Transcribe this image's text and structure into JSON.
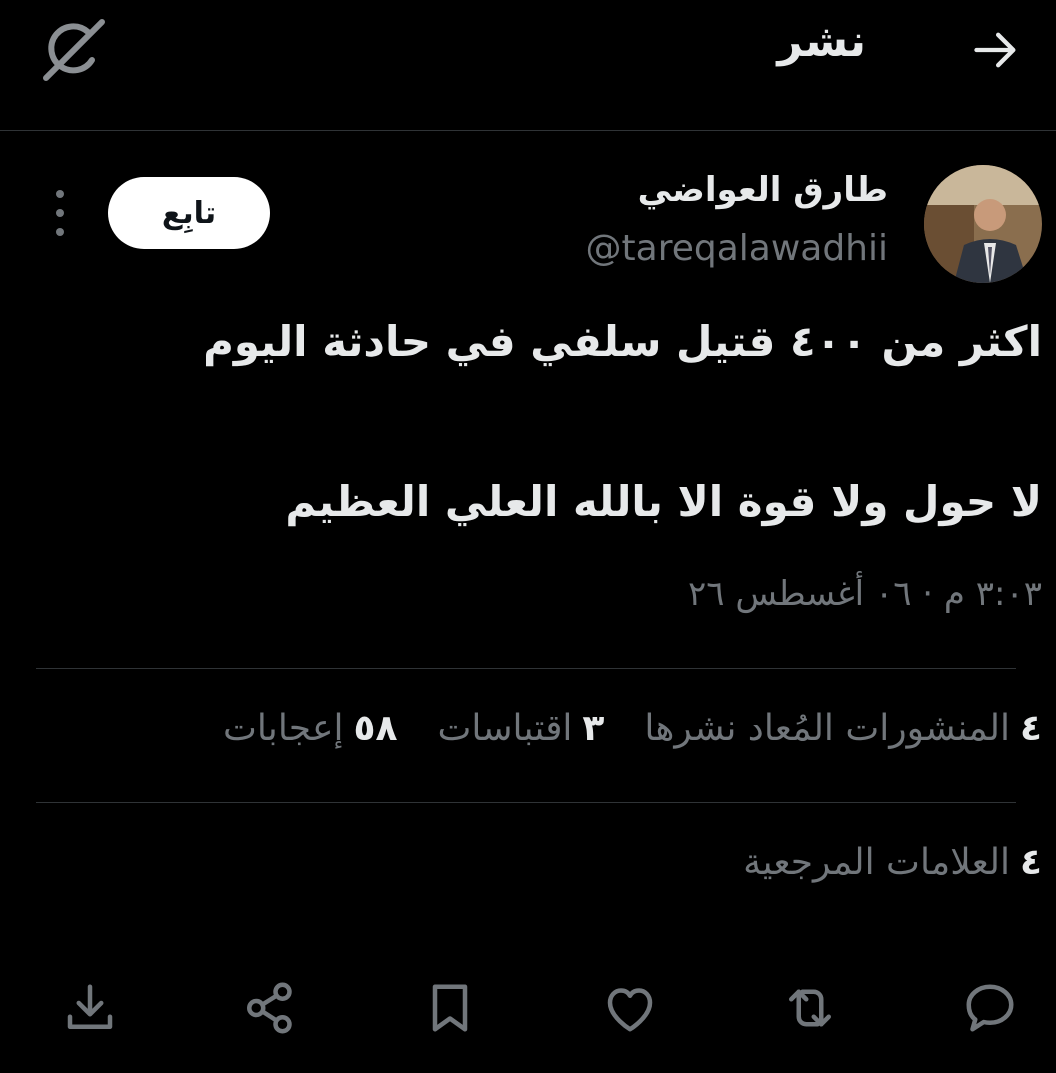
{
  "header": {
    "title": "نشر",
    "back_icon": "arrow-right-icon",
    "logo_icon": "grok-logo-icon"
  },
  "tweet": {
    "author_name": "طارق العواضي",
    "author_handle": "@tareqalawadhii",
    "follow_label": "تابِع",
    "text_line1": "اكثر من ٤٠٠ قتيل سلفي في حادثة اليوم",
    "text_line2": "لا حول ولا قوة الا بالله العلي العظيم",
    "timestamp": "٣:٠٣ م · ٠٦ أغسطس ٢٦"
  },
  "stats": {
    "reposts_count": "٤",
    "reposts_label": "المنشورات المُعاد نشرها",
    "quotes_count": "٣",
    "quotes_label": "اقتباسات",
    "likes_count": "٥٨",
    "likes_label": "إعجابات",
    "bookmarks_count": "٤",
    "bookmarks_label": "العلامات المرجعية"
  },
  "actions": [
    "reply-icon",
    "repost-icon",
    "like-icon",
    "bookmark-icon",
    "share-icon",
    "download-icon"
  ],
  "colors": {
    "background": "#000000",
    "text": "#e7e9ea",
    "muted": "#71767b",
    "divider": "#2f3336"
  }
}
